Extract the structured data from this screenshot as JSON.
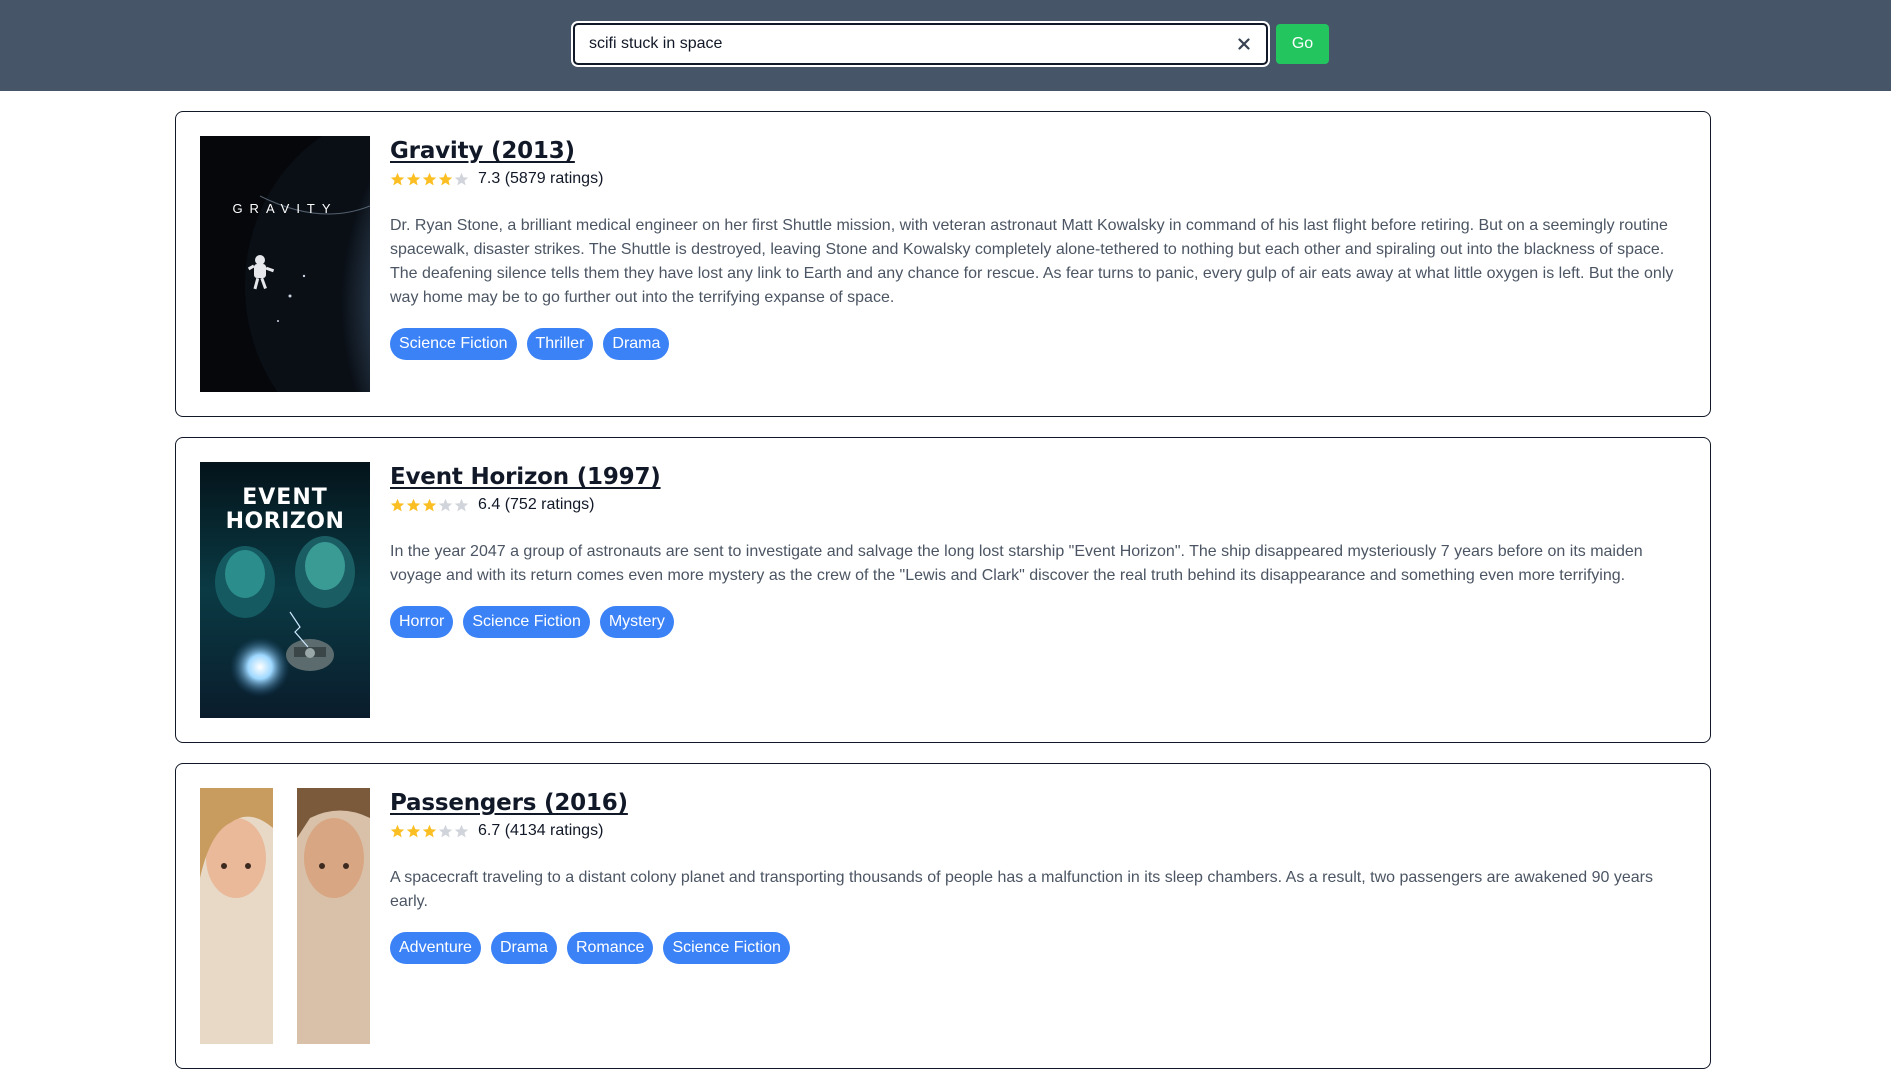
{
  "search": {
    "value": "scifi stuck in space",
    "go_label": "Go",
    "clear_glyph": "✕"
  },
  "colors": {
    "header_bg": "#475569",
    "go_button": "#22c55e",
    "tag_bg": "#3b82f6",
    "star_filled": "#fbbf24",
    "star_empty": "#d1d5db"
  },
  "results": [
    {
      "title": "Gravity (2013)",
      "poster_text": "GRAVITY",
      "stars_filled": 4,
      "stars_total": 5,
      "rating_text": "7.3 (5879 ratings)",
      "description": "Dr. Ryan Stone, a brilliant medical engineer on her first Shuttle mission, with veteran astronaut Matt Kowalsky in command of his last flight before retiring. But on a seemingly routine spacewalk, disaster strikes. The Shuttle is destroyed, leaving Stone and Kowalsky completely alone-tethered to nothing but each other and spiraling out into the blackness of space. The deafening silence tells them they have lost any link to Earth and any chance for rescue. As fear turns to panic, every gulp of air eats away at what little oxygen is left. But the only way home may be to go further out into the terrifying expanse of space.",
      "genres": [
        "Science Fiction",
        "Thriller",
        "Drama"
      ]
    },
    {
      "title": "Event Horizon (1997)",
      "poster_text_1": "EVENT",
      "poster_text_2": "HORIZON",
      "stars_filled": 3,
      "stars_total": 5,
      "rating_text": "6.4 (752 ratings)",
      "description": "In the year 2047 a group of astronauts are sent to investigate and salvage the long lost starship \"Event Horizon\". The ship disappeared mysteriously 7 years before on its maiden voyage and with its return comes even more mystery as the crew of the \"Lewis and Clark\" discover the real truth behind its disappearance and something even more terrifying.",
      "genres": [
        "Horror",
        "Science Fiction",
        "Mystery"
      ]
    },
    {
      "title": "Passengers (2016)",
      "stars_filled": 3,
      "stars_total": 5,
      "rating_text": "6.7 (4134 ratings)",
      "description": "A spacecraft traveling to a distant colony planet and transporting thousands of people has a malfunction in its sleep chambers. As a result, two passengers are awakened 90 years early.",
      "genres": [
        "Adventure",
        "Drama",
        "Romance",
        "Science Fiction"
      ]
    }
  ]
}
